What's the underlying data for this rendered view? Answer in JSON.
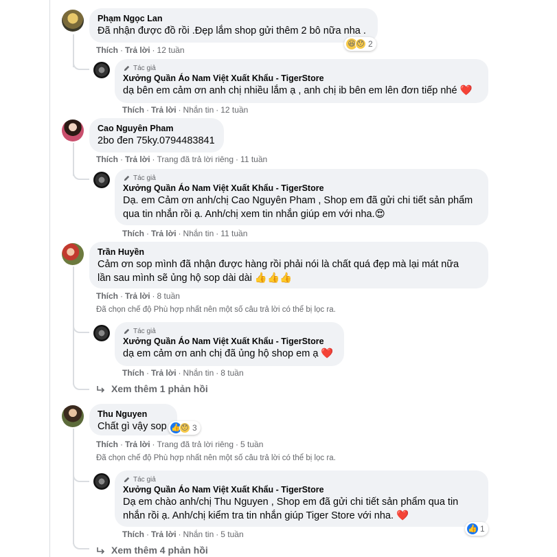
{
  "author_tag_label": "Tác giả",
  "page_name": "Xưởng Quần Áo Nam Việt Xuất Khẩu - TigerStore",
  "actions": {
    "like": "Thích",
    "reply": "Trả lời",
    "message": "Nhắn tin"
  },
  "filter_note": "Đã chọn chế độ Phù hợp nhất nên một số câu trả lời có thể bị lọc ra.",
  "threads": [
    {
      "name": "Phạm Ngọc Lan",
      "text": "Đã nhận được đồ rồi .Đẹp lắm shop gửi thêm 2 bô nữa nha .",
      "time": "12 tuần",
      "reaction_count": "2",
      "reply": {
        "text": "dạ bên em cảm ơn anh chị nhiều lắm ạ , anh chị ib bên em lên đơn tiếp nhé ❤️",
        "time": "12 tuần"
      }
    },
    {
      "name": "Cao Nguyên Pham",
      "text": "2bo đen 75ky.0794483841",
      "private_note": "Trang đã trả lời riêng",
      "time": "11 tuần",
      "reply": {
        "text_line1": "Dạ. em Cảm ơn anh/chị Cao Nguyên Pham , Shop em đã gửi chi tiết sản phẩm",
        "text_line2": "qua tin nhắn rồi ạ. Anh/chị xem tin nhắn giúp em với nha.😍",
        "time": "11 tuần"
      }
    },
    {
      "name": "Trần Huyền",
      "text_line1": "Cảm ơn sop mình đã nhận được hàng rồi phải nói là chất quá đẹp mà lại mát nữa",
      "text_line2": "lần sau mình sẽ ủng hộ sop dài dài 👍👍👍",
      "time": "8 tuần",
      "reply": {
        "text": "dạ em cảm ơn anh chị đã ủng hộ shop em ạ ❤️",
        "time": "8 tuần"
      },
      "more_replies": "Xem thêm 1 phản hồi"
    },
    {
      "name": "Thu Nguyen",
      "text": "Chất gì vậy sop",
      "reaction_count": "3",
      "private_note": "Trang đã trả lời riêng",
      "time": "5 tuần",
      "reply": {
        "text_line1": "Dạ em chào anh/chị Thu Nguyen , Shop em đã gửi chi tiết sản phẩm qua tin",
        "text_line2": "nhắn rồi ạ. Anh/chị kiểm tra tin nhắn giúp Tiger Store với nha. ❤️",
        "time": "5 tuần",
        "reaction_count": "1"
      },
      "more_replies": "Xem thêm 4 phản hồi"
    }
  ]
}
